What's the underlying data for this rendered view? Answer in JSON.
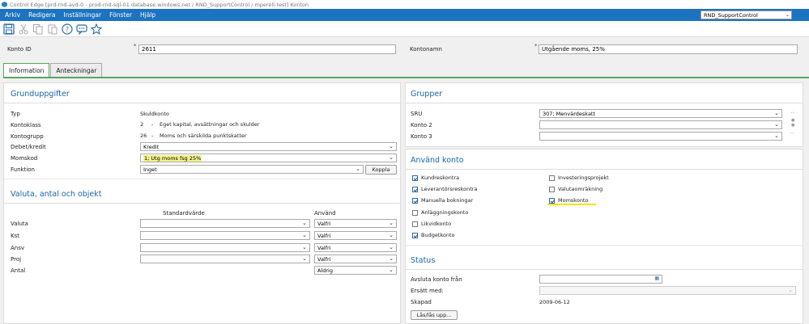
{
  "window": {
    "title": "Control Edge [prd-rnd-avd-0 - prod-rnd-sql-01.database.windows.net / RND_SupportControl / mperell-test] Konton"
  },
  "menu": [
    "Arkiv",
    "Redigera",
    "Inställningar",
    "Fönster",
    "Hjälp"
  ],
  "company_select": "RND_SupportControl",
  "toolbar": {
    "icons": [
      "save-icon",
      "cut-icon",
      "copy-icon",
      "paste-icon",
      "help-icon",
      "chat-icon",
      "star-icon"
    ]
  },
  "account": {
    "id_label": "Konto ID",
    "id_value": "2611",
    "name_label": "Kontonamn",
    "name_value": "Utgående moms, 25%",
    "required_mark": "*"
  },
  "tabs": [
    {
      "label": "Information",
      "active": true
    },
    {
      "label": "Anteckningar",
      "active": false
    }
  ],
  "grunduppgifter": {
    "title": "Grunduppgifter",
    "typ_label": "Typ",
    "typ_value": "Skuldkonto",
    "kontoklass_label": "Kontoklass",
    "kontoklass_code": "2",
    "kontoklass_dash": "-",
    "kontoklass_value": "Eget kapital, avsättningar och skulder",
    "kontogrupp_label": "Kontogrupp",
    "kontogrupp_code": "26",
    "kontogrupp_dash": "-",
    "kontogrupp_value": "Moms och särskilda punktskatter",
    "debet_label": "Debet/kredit",
    "debet_value": "Kredit",
    "momskod_label": "Momskod",
    "momskod_value": "1; Utg moms fsg 25%",
    "funktion_label": "Funktion",
    "funktion_value": "Inget",
    "koppla_label": "Koppla"
  },
  "valuta": {
    "title": "Valuta, antal och objekt",
    "col_standard": "Standardvärde",
    "col_anvand": "Använd",
    "rows": [
      {
        "label": "Valuta",
        "use": "Valfri"
      },
      {
        "label": "Kst",
        "use": "Valfri"
      },
      {
        "label": "Ansv",
        "use": "Valfri"
      },
      {
        "label": "Proj",
        "use": "Valfri"
      },
      {
        "label": "Antal",
        "use": "Aldrig"
      }
    ]
  },
  "grupper": {
    "title": "Grupper",
    "rows": [
      {
        "label": "SRU",
        "value": "307; Menvärdeskatt"
      },
      {
        "label": "Konto 2",
        "value": ""
      },
      {
        "label": "Konto 3",
        "value": ""
      }
    ]
  },
  "anvand_konto": {
    "title": "Använd konto",
    "left": [
      {
        "label": "Kundreskontra",
        "checked": true
      },
      {
        "label": "Leverantörsreskontra",
        "checked": true
      },
      {
        "label": "Manuella bokningar",
        "checked": true
      },
      {
        "label": "Anläggningskonto",
        "checked": false
      },
      {
        "label": "Likvidkonto",
        "checked": false
      },
      {
        "label": "Budgetkonto",
        "checked": true
      }
    ],
    "right": [
      {
        "label": "Investeringsprojekt",
        "checked": false
      },
      {
        "label": "Valutaomräkning",
        "checked": false
      },
      {
        "label": "Momskonto",
        "checked": true
      }
    ]
  },
  "status": {
    "title": "Status",
    "avsluta_label": "Avsluta konto från",
    "ersatt_label": "Ersätt med:",
    "skapad_label": "Skapad",
    "skapad_value": "2009-06-12",
    "lock_button": "Lås/lås upp..."
  }
}
